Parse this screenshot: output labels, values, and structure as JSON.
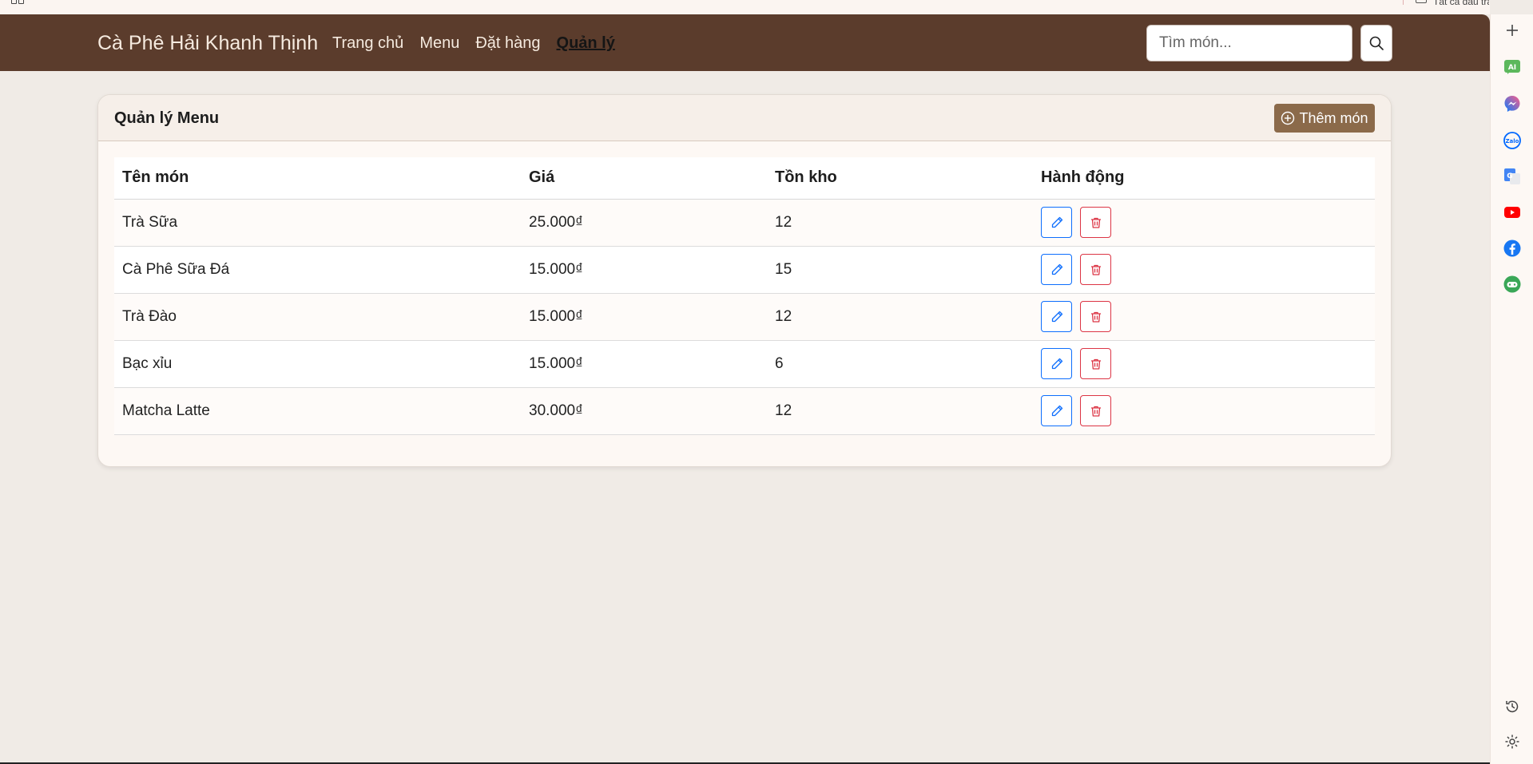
{
  "browser": {
    "bookmark_text": "Tất cả dấu trang"
  },
  "navbar": {
    "brand": "Cà Phê Hải Khanh Thịnh",
    "links": [
      {
        "label": "Trang chủ",
        "active": false
      },
      {
        "label": "Menu",
        "active": false
      },
      {
        "label": "Đặt hàng",
        "active": false
      },
      {
        "label": "Quản lý",
        "active": true
      }
    ],
    "search_placeholder": "Tìm món..."
  },
  "card": {
    "title": "Quản lý Menu",
    "add_button": "Thêm món"
  },
  "table": {
    "headers": [
      "Tên món",
      "Giá",
      "Tồn kho",
      "Hành động"
    ],
    "rows": [
      {
        "name": "Trà Sữa",
        "price": "25.000₫",
        "stock": "12"
      },
      {
        "name": "Cà Phê Sữa Đá",
        "price": "15.000₫",
        "stock": "15"
      },
      {
        "name": "Trà Đào",
        "price": "15.000₫",
        "stock": "12"
      },
      {
        "name": "Bạc xỉu",
        "price": "15.000₫",
        "stock": "6"
      },
      {
        "name": "Matcha Latte",
        "price": "30.000₫",
        "stock": "12"
      }
    ]
  },
  "sidebar": {
    "icons": [
      "plus-icon",
      "ai-icon",
      "messenger-icon",
      "zalo-icon",
      "translate-icon",
      "youtube-icon",
      "facebook-icon",
      "game-icon",
      "history-icon",
      "settings-icon"
    ]
  },
  "colors": {
    "navbar": "#5b3c2c",
    "accent_button": "#8b6a4a",
    "edit": "#0d6efd",
    "delete": "#dc3545",
    "page_bg": "#f0ebe6"
  }
}
